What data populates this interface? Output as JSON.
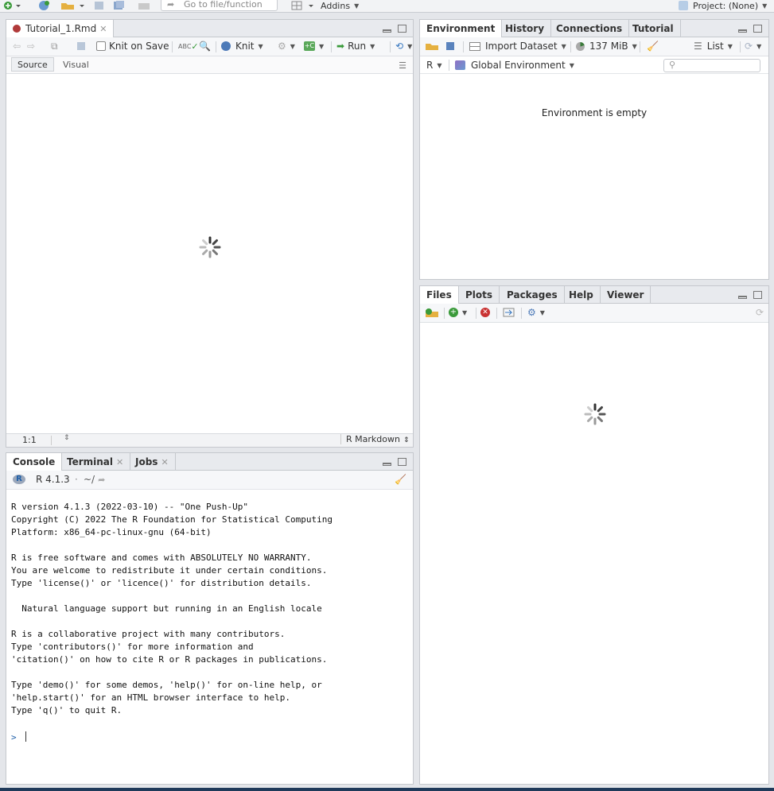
{
  "topbar": {
    "goto_placeholder": "Go to file/function",
    "addins_label": "Addins",
    "project_label": "Project: (None)"
  },
  "source": {
    "tab_label": "Tutorial_1.Rmd",
    "knit_on_save_label": "Knit on Save",
    "knit_label": "Knit",
    "run_label": "Run",
    "mode_source": "Source",
    "mode_visual": "Visual",
    "cursor_pos": "1:1",
    "file_type": "R Markdown"
  },
  "console": {
    "tabs": [
      "Console",
      "Terminal",
      "Jobs"
    ],
    "r_version_label": "R 4.1.3",
    "sep": "·",
    "path": "~/",
    "output": "R version 4.1.3 (2022-03-10) -- \"One Push-Up\"\nCopyright (C) 2022 The R Foundation for Statistical Computing\nPlatform: x86_64-pc-linux-gnu (64-bit)\n\nR is free software and comes with ABSOLUTELY NO WARRANTY.\nYou are welcome to redistribute it under certain conditions.\nType 'license()' or 'licence()' for distribution details.\n\n  Natural language support but running in an English locale\n\nR is a collaborative project with many contributors.\nType 'contributors()' for more information and\n'citation()' on how to cite R or R packages in publications.\n\nType 'demo()' for some demos, 'help()' for on-line help, or\n'help.start()' for an HTML browser interface to help.\nType 'q()' to quit R.",
    "prompt": ">"
  },
  "environment": {
    "tabs": [
      "Environment",
      "History",
      "Connections",
      "Tutorial"
    ],
    "import_label": "Import Dataset",
    "memory_label": "137 MiB",
    "list_label": "List",
    "lang_label": "R",
    "scope_label": "Global Environment",
    "empty_message": "Environment is empty"
  },
  "files": {
    "tabs": [
      "Files",
      "Plots",
      "Packages",
      "Help",
      "Viewer"
    ]
  }
}
